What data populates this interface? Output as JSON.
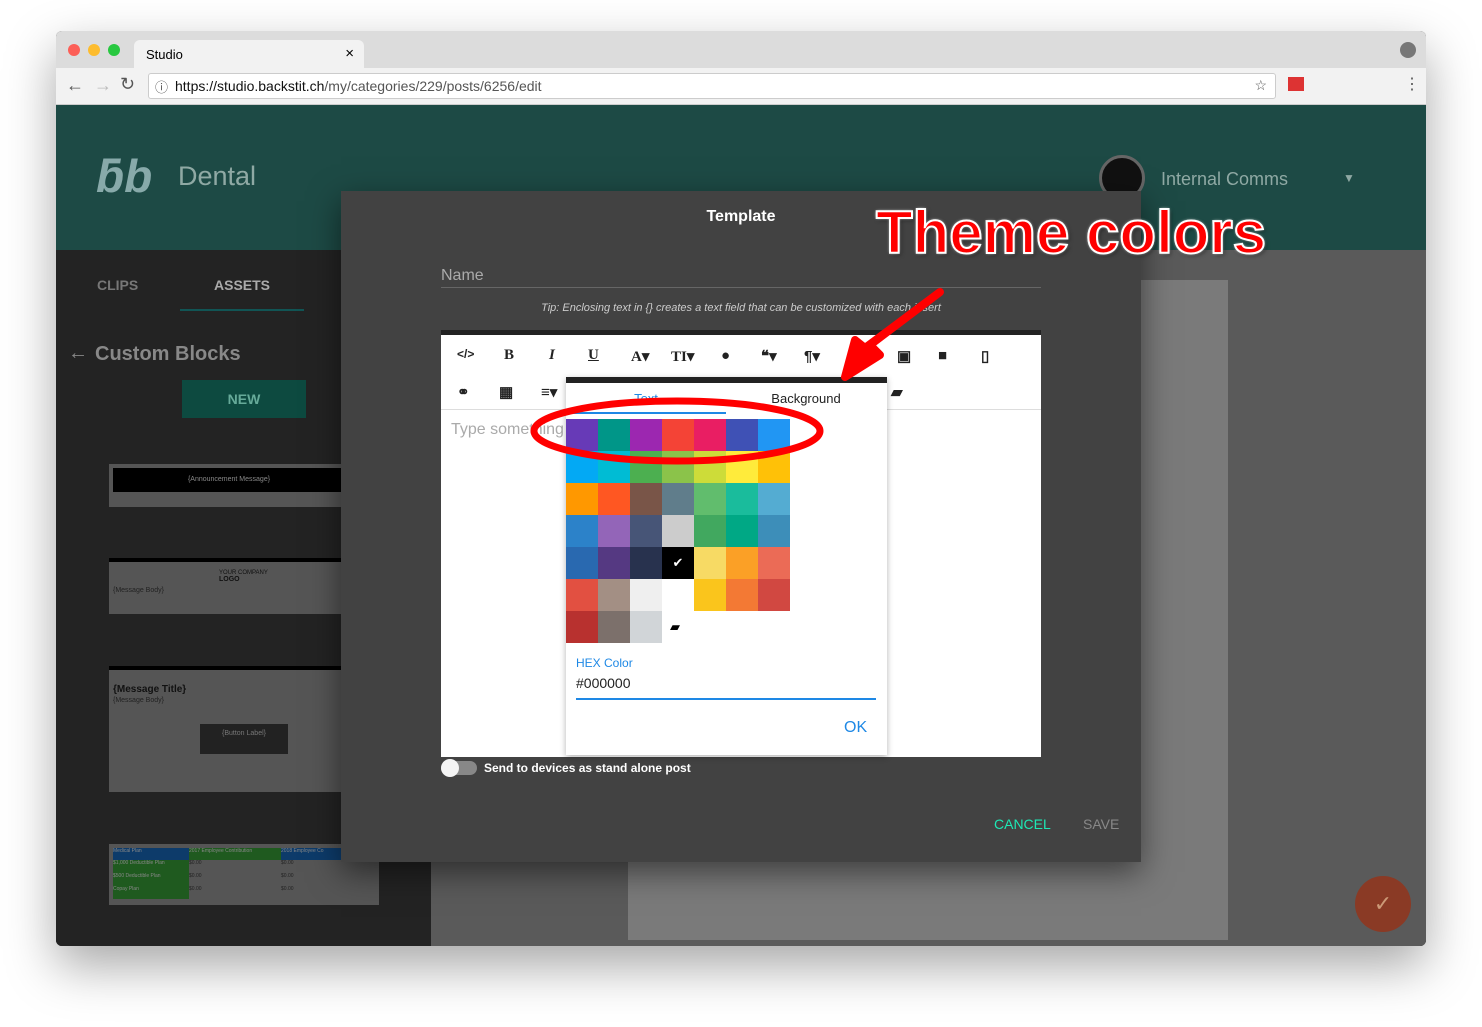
{
  "browser": {
    "tab_title": "Studio",
    "url_host": "https://studio.backstit.ch",
    "url_path": "/my/categories/229/posts/6256/edit"
  },
  "header": {
    "brand": "Dental",
    "account": "Internal Comms"
  },
  "sidebar": {
    "tabs": [
      "CLIPS",
      "ASSETS"
    ],
    "section_title": "Custom Blocks",
    "new_label": "NEW",
    "blocks": {
      "announcement": "{Announcement Message}",
      "logo_top": "YOUR COMPANY",
      "logo": "LOGO",
      "body": "{Message Body}",
      "title": "{Message Title}",
      "button": "{Button Label}",
      "table_headers": [
        "Medical Plan",
        "2017 Employee Contribution",
        "2018 Employee Co"
      ],
      "table_rows": [
        [
          "$1,000 Deductible Plan",
          "$0.00",
          "$0.00"
        ],
        [
          "$500 Deductible Plan",
          "$0.00",
          "$0.00"
        ],
        [
          "Copay Plan",
          "$0.00",
          "$0.00"
        ]
      ]
    }
  },
  "modal": {
    "title": "Template",
    "name_label": "Name",
    "tip": "Tip: Enclosing text in {} creates a text field that can be customized with each insert",
    "placeholder": "Type something",
    "toggle_label": "Send to devices as stand alone post",
    "toggle_on": false,
    "cancel": "CANCEL",
    "save": "SAVE"
  },
  "color_popup": {
    "tabs": [
      "Text",
      "Background"
    ],
    "active_tab": "Text",
    "hex_label": "HEX Color",
    "hex_value": "#000000",
    "ok": "OK",
    "selected": "#000000",
    "palette": [
      [
        "#673AB7",
        "#009688",
        "#9C27B0",
        "#F44336",
        "#E91E63",
        "#3F51B5",
        "#2196F3"
      ],
      [
        "#03A9F4",
        "#00BCD4",
        "#4CAF50",
        "#8BC34A",
        "#CDDC39",
        "#FFEB3B",
        "#FFC107"
      ],
      [
        "#FF9800",
        "#FF5722",
        "#795548",
        "#607D8B",
        "#61BD6D",
        "#1ABC9C",
        "#54ACD2"
      ],
      [
        "#2C82C9",
        "#9365B8",
        "#475577",
        "#CCCCCC",
        "#41A85F",
        "#00A885",
        "#3D8EB9"
      ],
      [
        "#2969B0",
        "#553982",
        "#28324E",
        "#000000",
        "#F7DA64",
        "#FBA026",
        "#EB6B56"
      ],
      [
        "#E25041",
        "#A38F84",
        "#EFEFEF",
        "#FFFFFF",
        "#FAC51C",
        "#F37934",
        "#D14841"
      ],
      [
        "#B8312F",
        "#7C706B",
        "#D1D5D8"
      ]
    ]
  },
  "annotation": {
    "text": "Theme colors",
    "color": "#FF0000"
  },
  "colors": {
    "accent": "#1DE9B6",
    "header": "#1d4a45",
    "fab": "#8a3a25"
  }
}
